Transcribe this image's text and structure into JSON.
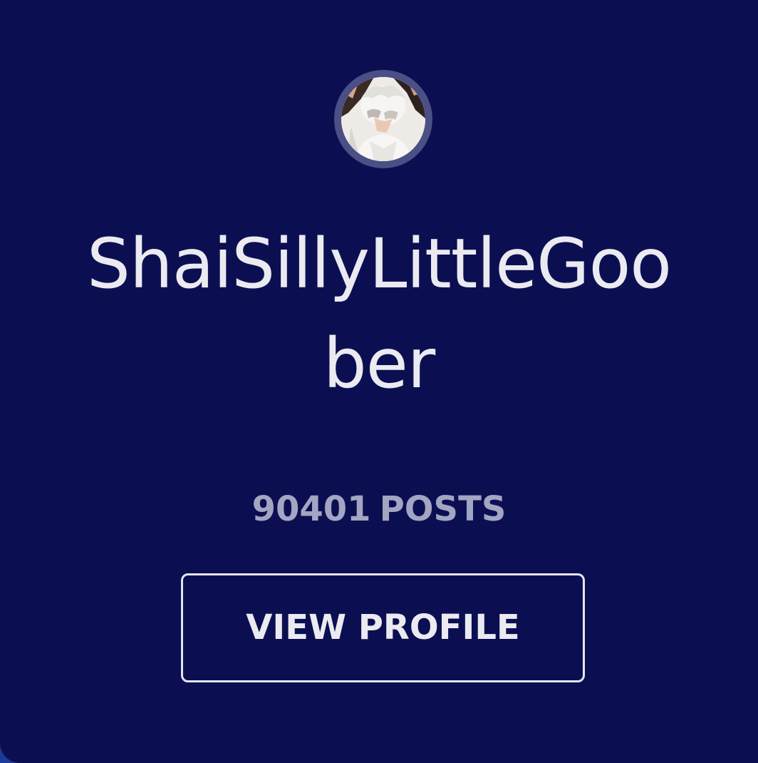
{
  "profile": {
    "username": "ShaiSillyLittleGoober",
    "post_count": "90401",
    "post_label": "POSTS",
    "avatar_icon": "avatar-image"
  },
  "actions": {
    "view_profile_label": "VIEW PROFILE"
  },
  "colors": {
    "card_background": "#0b0f52",
    "outer_background": "#1b3a9a",
    "text_primary": "#ebeaf0",
    "text_secondary": "#a3a5c2",
    "avatar_ring": "#4a4f86"
  }
}
